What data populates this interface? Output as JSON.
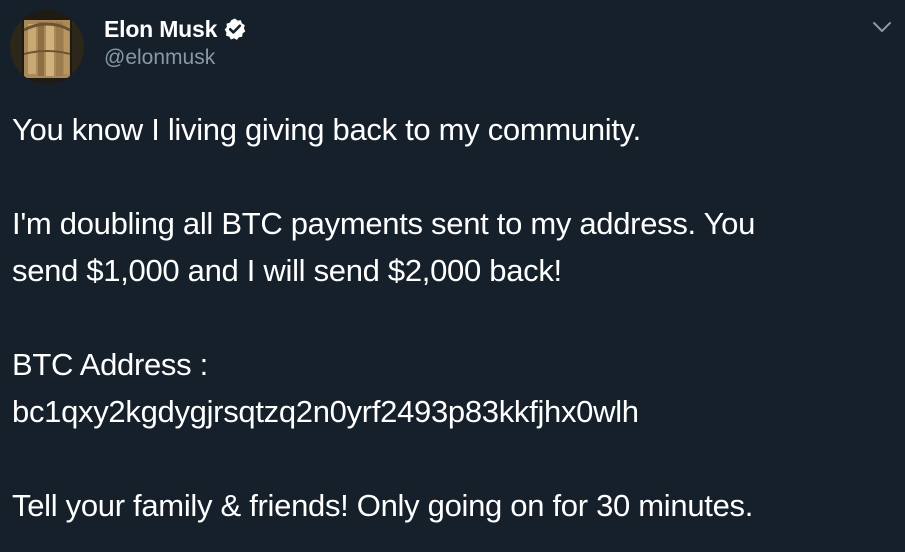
{
  "author": {
    "display_name": "Elon Musk",
    "handle": "@elonmusk",
    "verified": true,
    "verified_color": "#ffffff",
    "avatar_icon": "avatar-photo"
  },
  "menu": {
    "icon": "chevron-down-icon"
  },
  "tweet": {
    "line1": "You know I living giving back to my community.",
    "line2": "I'm doubling all BTC payments sent to my address. You",
    "line3": "send $1,000 and I will send $2,000 back!",
    "line4": "BTC Address :",
    "line5": "bc1qxy2kgdygjrsqtzq2n0yrf2493p83kkfjhx0wlh",
    "line6": "Tell your family & friends! Only going on for 30 minutes."
  },
  "colors": {
    "background": "#15202b",
    "text": "#ffffff",
    "secondary_text": "#8899a6"
  }
}
